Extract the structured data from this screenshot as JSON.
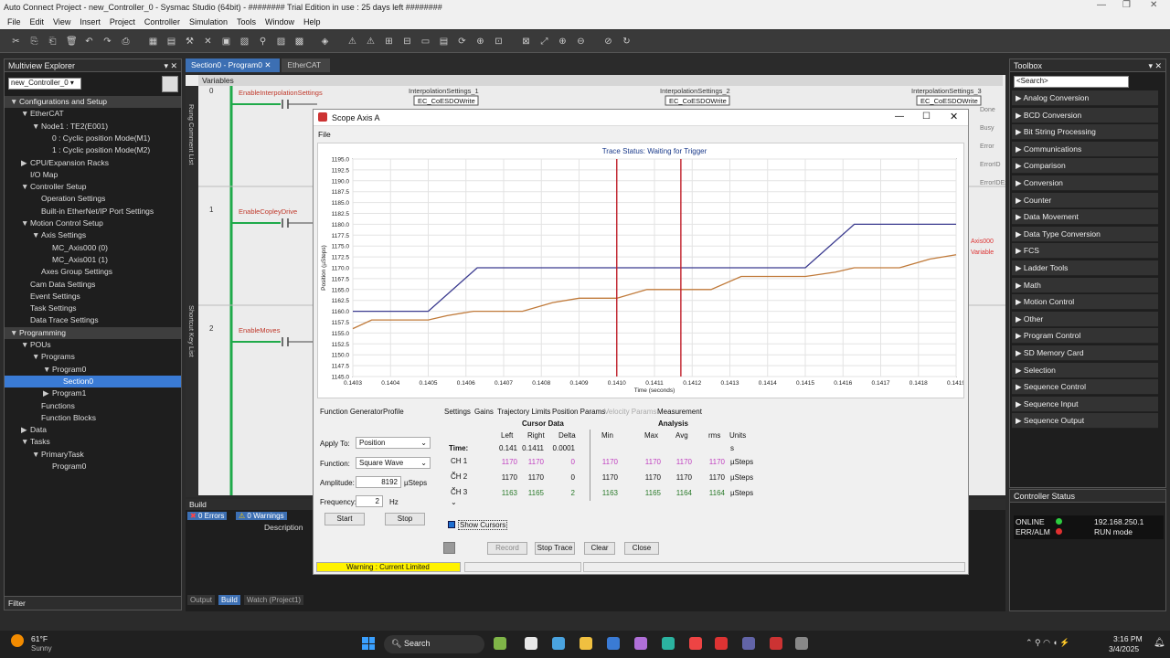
{
  "app": {
    "title": "Auto Connect Project - new_Controller_0 - Sysmac Studio (64bit) - ######## Trial Edition in use : 25 days left ########"
  },
  "menu": [
    "File",
    "Edit",
    "View",
    "Insert",
    "Project",
    "Controller",
    "Simulation",
    "Tools",
    "Window",
    "Help"
  ],
  "explorer": {
    "title": "Multiview Explorer",
    "controller": "new_Controller_0",
    "items": [
      {
        "label": "Configurations and Setup",
        "level": 0,
        "cat": true,
        "arrow": "▼"
      },
      {
        "label": "EtherCAT",
        "level": 1,
        "arrow": "▼"
      },
      {
        "label": "Node1 : TE2(E001)",
        "level": 2,
        "arrow": "▼"
      },
      {
        "label": "0 : Cyclic position Mode(M1)",
        "level": 3,
        "arrow": ""
      },
      {
        "label": "1 : Cyclic position Mode(M2)",
        "level": 3,
        "arrow": ""
      },
      {
        "label": "CPU/Expansion Racks",
        "level": 1,
        "arrow": "▶"
      },
      {
        "label": "I/O Map",
        "level": 1,
        "arrow": ""
      },
      {
        "label": "Controller Setup",
        "level": 1,
        "arrow": "▼"
      },
      {
        "label": "Operation Settings",
        "level": 2,
        "arrow": ""
      },
      {
        "label": "Built-in EtherNet/IP Port Settings",
        "level": 2,
        "arrow": ""
      },
      {
        "label": "Motion Control Setup",
        "level": 1,
        "arrow": "▼"
      },
      {
        "label": "Axis Settings",
        "level": 2,
        "arrow": "▼"
      },
      {
        "label": "MC_Axis000 (0)",
        "level": 3,
        "arrow": ""
      },
      {
        "label": "MC_Axis001 (1)",
        "level": 3,
        "arrow": ""
      },
      {
        "label": "Axes Group Settings",
        "level": 2,
        "arrow": ""
      },
      {
        "label": "Cam Data Settings",
        "level": 1,
        "arrow": ""
      },
      {
        "label": "Event Settings",
        "level": 1,
        "arrow": ""
      },
      {
        "label": "Task Settings",
        "level": 1,
        "arrow": ""
      },
      {
        "label": "Data Trace Settings",
        "level": 1,
        "arrow": ""
      },
      {
        "label": "Programming",
        "level": 0,
        "cat": true,
        "arrow": "▼"
      },
      {
        "label": "POUs",
        "level": 1,
        "arrow": "▼"
      },
      {
        "label": "Programs",
        "level": 2,
        "arrow": "▼"
      },
      {
        "label": "Program0",
        "level": 3,
        "arrow": "▼"
      },
      {
        "label": "Section0",
        "level": 4,
        "arrow": "",
        "sel": true
      },
      {
        "label": "Program1",
        "level": 3,
        "arrow": "▶"
      },
      {
        "label": "Functions",
        "level": 2,
        "arrow": ""
      },
      {
        "label": "Function Blocks",
        "level": 2,
        "arrow": ""
      },
      {
        "label": "Data",
        "level": 1,
        "arrow": "▶"
      },
      {
        "label": "Tasks",
        "level": 1,
        "arrow": "▼"
      },
      {
        "label": "PrimaryTask",
        "level": 2,
        "arrow": "▼"
      },
      {
        "label": "Program0",
        "level": 3,
        "arrow": ""
      }
    ],
    "filter": "Filter"
  },
  "editor": {
    "tabs": [
      "Section0 - Program0",
      "EtherCAT"
    ],
    "variables": "Variables",
    "rung_comment": "Rung Comment List",
    "shortcut": "Shortcut Key List",
    "rungs": [
      {
        "num": "0",
        "label": "EnableInterpolationSettings"
      },
      {
        "num": "1",
        "label": "EnableCopleyDrive"
      },
      {
        "num": "2",
        "label": "EnableMoves"
      }
    ],
    "fbs": [
      {
        "name": "InterpolationSettings_1",
        "type": "EC_CoESDOWrite"
      },
      {
        "name": "InterpolationSettings_2",
        "type": "EC_CoESDOWrite"
      },
      {
        "name": "InterpolationSettings_3",
        "type": "EC_CoESDOWrite"
      }
    ],
    "side_labels": [
      "Done",
      "Busy",
      "Error",
      "ErrorID",
      "ErrorIDEx",
      "Axis000",
      "Variable"
    ]
  },
  "build": {
    "title": "Build",
    "errors": "0 Errors",
    "warnings": "0 Warnings",
    "col": "Description",
    "tabs": [
      "Output",
      "Build",
      "Watch (Project1)"
    ]
  },
  "toolbox": {
    "title": "Toolbox",
    "search": "<Search>",
    "items": [
      "Analog Conversion",
      "BCD Conversion",
      "Bit String Processing",
      "Communications",
      "Comparison",
      "Conversion",
      "Counter",
      "Data Movement",
      "Data Type Conversion",
      "FCS",
      "Ladder Tools",
      "Math",
      "Motion Control",
      "Other",
      "Program Control",
      "SD Memory Card",
      "Selection",
      "Sequence Control",
      "Sequence Input",
      "Sequence Output"
    ]
  },
  "ctrl_status": {
    "title": "Controller Status",
    "online": "ONLINE",
    "ip": "192.168.250.1",
    "erralm": "ERR/ALM",
    "mode": "RUN mode",
    "online_color": "#2ecc40",
    "err_color": "#e03030"
  },
  "scope": {
    "title": "Scope Axis A",
    "menu_file": "File",
    "trace_status": "Trace Status:  Waiting for Trigger",
    "fg_tabs": [
      "Function Generator",
      "Profile"
    ],
    "apply_to_label": "Apply To:",
    "apply_to": "Position",
    "function_label": "Function:",
    "function": "Square Wave",
    "amplitude_label": "Amplitude:",
    "amplitude": "8192",
    "amplitude_unit": "µSteps",
    "frequency_label": "Frequency:",
    "frequency": "2",
    "frequency_unit": "Hz",
    "start": "Start",
    "stop": "Stop",
    "meas_tabs": [
      "Settings",
      "Gains",
      "Trajectory Limits",
      "Position Params",
      "Velocity Params",
      "Measurement"
    ],
    "cursor_data": "Cursor Data",
    "analysis": "Analysis",
    "cols": [
      "Left",
      "Right",
      "Delta",
      "Min",
      "Max",
      "Avg",
      "rms",
      "Units"
    ],
    "time_label": "Time:",
    "time": [
      "0.141",
      "0.1411",
      "0.0001"
    ],
    "time_unit": "s",
    "rows": [
      {
        "ch": "CH 1",
        "vals": [
          "1170",
          "1170",
          "0",
          "1170",
          "1170",
          "1170",
          "1170"
        ],
        "unit": "µSteps",
        "cls": "pink"
      },
      {
        "ch": "CH 2",
        "vals": [
          "1170",
          "1170",
          "0",
          "1170",
          "1170",
          "1170",
          "1170"
        ],
        "unit": "µSteps",
        "cls": ""
      },
      {
        "ch": "CH 3",
        "vals": [
          "1163",
          "1165",
          "2",
          "1163",
          "1165",
          "1164",
          "1164"
        ],
        "unit": "µSteps",
        "cls": "grn"
      }
    ],
    "show_cursors": "Show Cursors",
    "record": "Record",
    "stop_trace": "Stop Trace",
    "clear": "Clear",
    "close": "Close",
    "warning": "Warning      : Current Limited"
  },
  "chart_data": {
    "type": "line",
    "title": "Trace Status:  Waiting for Trigger",
    "xlabel": "Time (seconds)",
    "ylabel": "Position (µSteps)",
    "xlim": [
      0.1403,
      0.1419
    ],
    "ylim": [
      1145,
      1195
    ],
    "x_ticks": [
      "0.1403",
      "0.1404",
      "0.1405",
      "0.1406",
      "0.1407",
      "0.1408",
      "0.1409",
      "0.1410",
      "0.1411",
      "0.1412",
      "0.1413",
      "0.1414",
      "0.1415",
      "0.1416",
      "0.1417",
      "0.1418",
      "0.1419"
    ],
    "y_ticks": [
      "1195.0",
      "1192.5",
      "1190.0",
      "1187.5",
      "1185.0",
      "1182.5",
      "1180.0",
      "1177.5",
      "1175.0",
      "1172.5",
      "1170.0",
      "1167.5",
      "1165.0",
      "1162.5",
      "1160.0",
      "1157.5",
      "1155.0",
      "1152.5",
      "1150.0",
      "1147.5",
      "1145.0"
    ],
    "cursors": [
      0.141,
      0.14117
    ],
    "series": [
      {
        "color": "#3b3b8f",
        "x": [
          0.1403,
          0.1405,
          0.14063,
          0.1415,
          0.14163,
          0.1419
        ],
        "y": [
          1160,
          1160,
          1170,
          1170,
          1180,
          1180
        ]
      },
      {
        "color": "#c07a3a",
        "x": [
          0.1403,
          0.14035,
          0.14038,
          0.1405,
          0.14055,
          0.14062,
          0.14075,
          0.14083,
          0.1409,
          0.141,
          0.14108,
          0.14113,
          0.14125,
          0.14133,
          0.1414,
          0.1415,
          0.14158,
          0.14163,
          0.14175,
          0.14183,
          0.1419
        ],
        "y": [
          1156,
          1158,
          1158,
          1158,
          1159,
          1160,
          1160,
          1162,
          1163,
          1163,
          1165,
          1165,
          1165,
          1168,
          1168,
          1168,
          1169,
          1170,
          1170,
          1172,
          1173
        ]
      }
    ]
  },
  "taskbar": {
    "temp": "61°F",
    "weather": "Sunny",
    "search": "Search",
    "time": "3:16 PM",
    "date": "3/4/2025"
  }
}
